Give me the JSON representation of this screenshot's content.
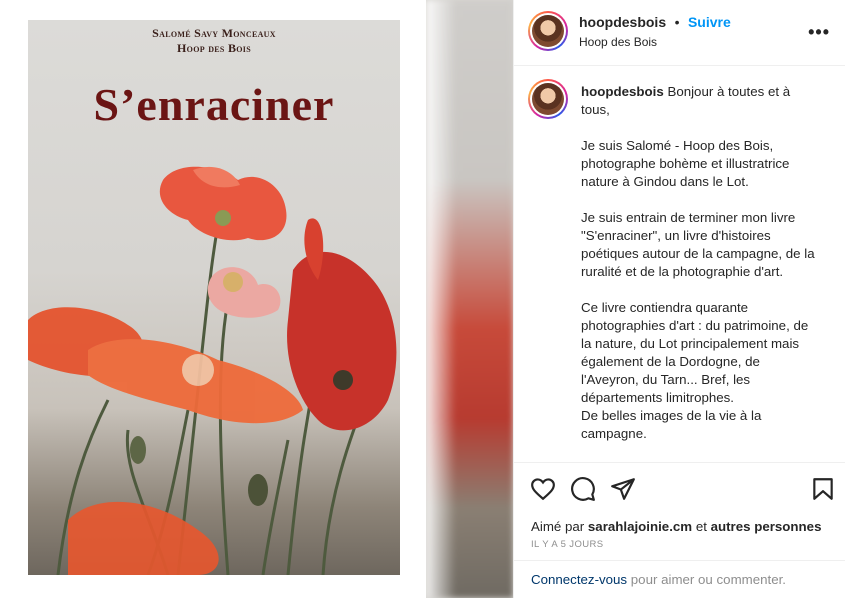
{
  "post_image": {
    "cover_author_line1": "Salomé Savy Monceaux",
    "cover_author_line2": "Hoop des Bois",
    "cover_title": "S’enraciner"
  },
  "header": {
    "username": "hoopdesbois",
    "separator": "•",
    "follow_label": "Suivre",
    "location": "Hoop des Bois",
    "more_icon": "more-horizontal-icon"
  },
  "caption": {
    "username": "hoopdesbois",
    "text": " Bonjour à toutes et à tous,\n\nJe suis Salomé - Hoop des Bois, photographe bohème et illustratrice nature à Gindou dans le Lot.\n\nJe suis entrain de terminer mon livre \"S'enraciner\", un livre d'histoires poétiques autour de la campagne, de la ruralité et de la photographie d'art.\n\nCe livre contiendra quarante photographies d'art : du patrimoine, de la nature, du Lot principalement mais également de la Dordogne, de l'Aveyron, du Tarn... Bref, les départements limitrophes.\nDe belles images de la vie à la campagne."
  },
  "actions": {
    "like_icon": "heart-icon",
    "comment_icon": "comment-icon",
    "share_icon": "send-icon",
    "save_icon": "bookmark-icon"
  },
  "likes": {
    "prefix": "Aimé par ",
    "user": "sarahlajoinie.cm",
    "middle": " et ",
    "suffix": "autres personnes"
  },
  "time_ago": "IL Y A 5 JOURS",
  "login_prompt": {
    "link": "Connectez-vous",
    "rest": " pour aimer ou commenter."
  },
  "colors": {
    "follow_blue": "#0095f6",
    "title_red": "#6b1514",
    "link_dark_blue": "#00376b"
  }
}
